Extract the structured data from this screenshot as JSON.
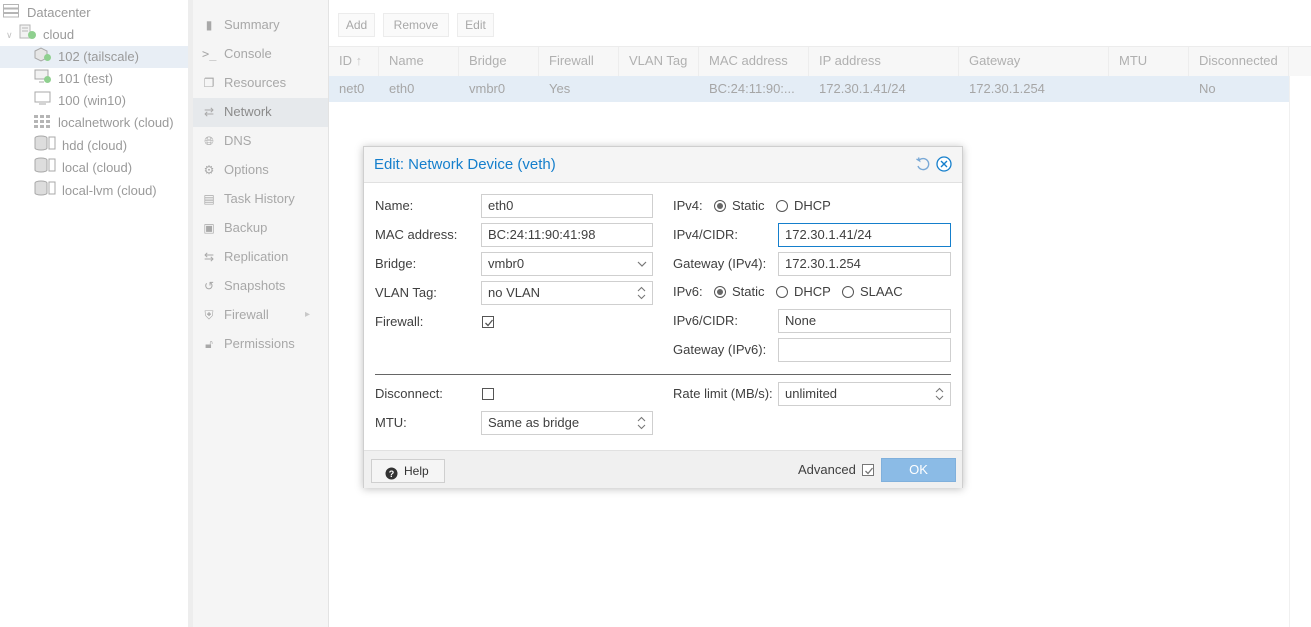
{
  "tree": {
    "items": [
      {
        "label": "Datacenter",
        "icon": "datacenter-icon"
      },
      {
        "label": "cloud",
        "icon": "node-icon"
      },
      {
        "label": "102 (tailscale)",
        "icon": "container-running-icon",
        "selected": true
      },
      {
        "label": "101 (test)",
        "icon": "vm-running-icon"
      },
      {
        "label": "100 (win10)",
        "icon": "vm-stopped-icon"
      },
      {
        "label": "localnetwork (cloud)",
        "icon": "network-grid-icon"
      },
      {
        "label": "hdd (cloud)",
        "icon": "storage-icon"
      },
      {
        "label": "local (cloud)",
        "icon": "storage-icon"
      },
      {
        "label": "local-lvm (cloud)",
        "icon": "storage-icon"
      }
    ]
  },
  "menu": {
    "items": [
      {
        "label": "Summary",
        "icon": "book-icon"
      },
      {
        "label": "Console",
        "icon": "terminal-icon"
      },
      {
        "label": "Resources",
        "icon": "cube-icon"
      },
      {
        "label": "Network",
        "icon": "exchange-icon",
        "active": true
      },
      {
        "label": "DNS",
        "icon": "globe-icon"
      },
      {
        "label": "Options",
        "icon": "gear-icon"
      },
      {
        "label": "Task History",
        "icon": "list-icon"
      },
      {
        "label": "Backup",
        "icon": "floppy-icon"
      },
      {
        "label": "Replication",
        "icon": "retweet-icon"
      },
      {
        "label": "Snapshots",
        "icon": "history-icon"
      },
      {
        "label": "Firewall",
        "icon": "shield-icon"
      },
      {
        "label": "Permissions",
        "icon": "unlock-icon"
      }
    ]
  },
  "toolbar": {
    "add": "Add",
    "remove": "Remove",
    "edit": "Edit"
  },
  "grid": {
    "columns": [
      "ID",
      "Name",
      "Bridge",
      "Firewall",
      "VLAN Tag",
      "MAC address",
      "IP address",
      "Gateway",
      "MTU",
      "Disconnected"
    ],
    "rows": [
      [
        "net0",
        "eth0",
        "vmbr0",
        "Yes",
        "",
        "BC:24:11:90:...",
        "172.30.1.41/24",
        "172.30.1.254",
        "",
        "No"
      ]
    ]
  },
  "dialog": {
    "title": "Edit: Network Device (veth)",
    "name_label": "Name:",
    "name_value": "eth0",
    "mac_label": "MAC address:",
    "mac_value": "BC:24:11:90:41:98",
    "bridge_label": "Bridge:",
    "bridge_value": "vmbr0",
    "vlan_label": "VLAN Tag:",
    "vlan_value": "no VLAN",
    "firewall_label": "Firewall:",
    "firewall_checked": true,
    "ipv4_label": "IPv4:",
    "ipv4_static": "Static",
    "ipv4_dhcp": "DHCP",
    "ipv4_mode": "Static",
    "ipv4_cidr_label": "IPv4/CIDR:",
    "ipv4_cidr_value": "172.30.1.41/24",
    "gw4_label": "Gateway (IPv4):",
    "gw4_value": "172.30.1.254",
    "ipv6_label": "IPv6:",
    "ipv6_static": "Static",
    "ipv6_dhcp": "DHCP",
    "ipv6_slaac": "SLAAC",
    "ipv6_mode": "Static",
    "ipv6_cidr_label": "IPv6/CIDR:",
    "ipv6_cidr_value": "None",
    "gw6_label": "Gateway (IPv6):",
    "gw6_value": "",
    "disconnect_label": "Disconnect:",
    "disconnect_checked": false,
    "mtu_label": "MTU:",
    "mtu_value": "Same as bridge",
    "rate_label": "Rate limit (MB/s):",
    "rate_value": "unlimited",
    "help": "Help",
    "advanced": "Advanced",
    "advanced_checked": true,
    "ok": "OK"
  },
  "colors": {
    "accent": "#157fcc",
    "ok_button": "#8bbbe6",
    "selected_row": "#e4edf6"
  }
}
